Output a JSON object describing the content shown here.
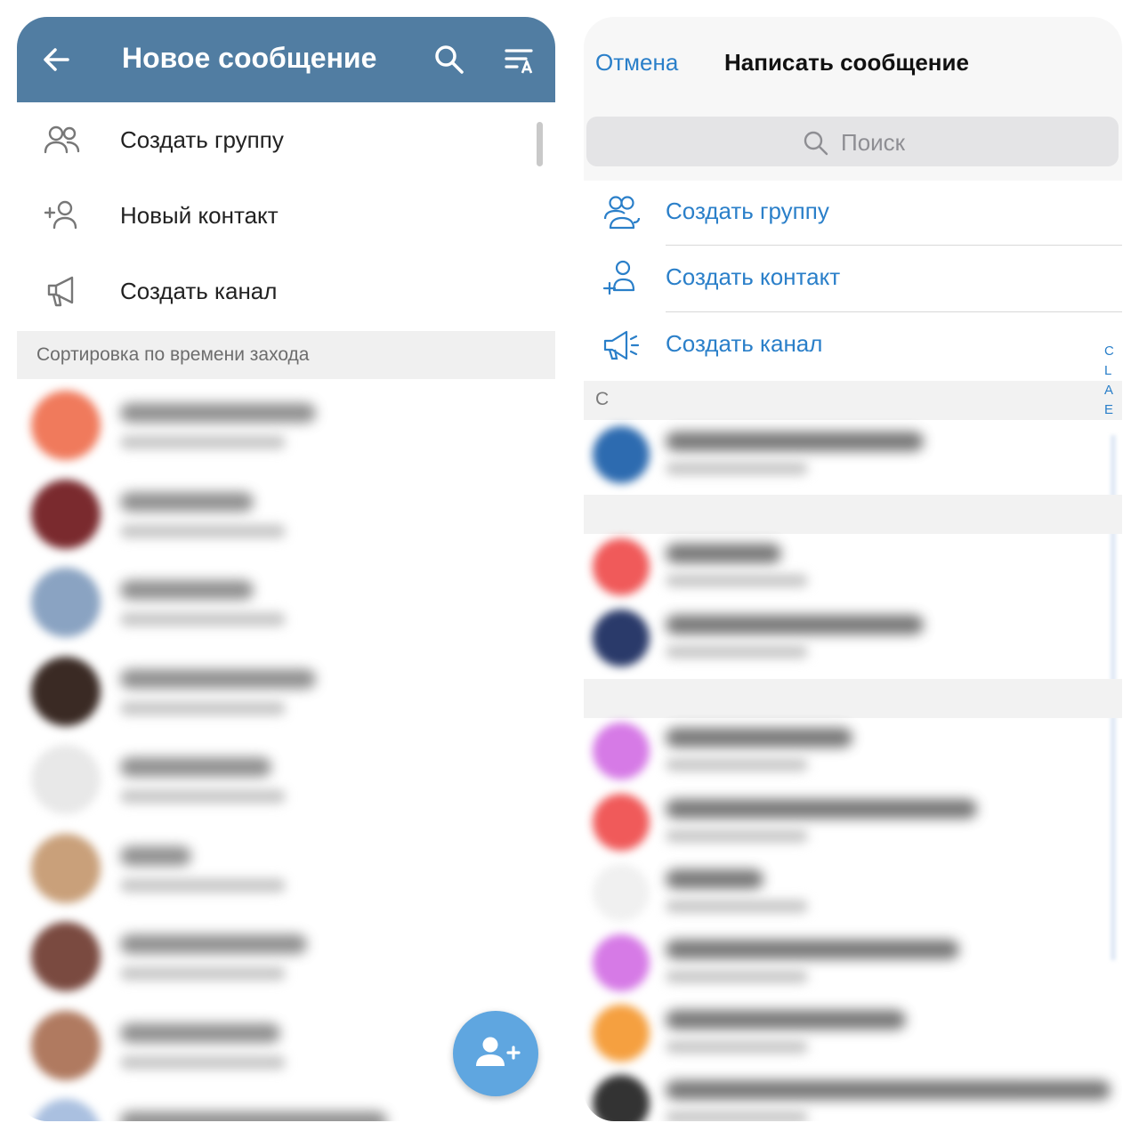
{
  "android": {
    "header": {
      "title": "Новое сообщение",
      "back_icon": "arrow-left-icon",
      "search_icon": "search-icon",
      "sort_icon": "sort-alpha-icon",
      "background": "#517da2"
    },
    "actions": [
      {
        "label": "Создать группу",
        "icon": "group-icon"
      },
      {
        "label": "Новый контакт",
        "icon": "add-contact-icon"
      },
      {
        "label": "Создать канал",
        "icon": "megaphone-icon"
      }
    ],
    "section_label": "Сортировка по времени захода",
    "contacts_blurred": true,
    "fab_icon": "add-person-icon",
    "fab_color": "#5fa6e0"
  },
  "ios": {
    "header": {
      "cancel": "Отмена",
      "title": "Написать сообщение"
    },
    "search": {
      "placeholder": "Поиск",
      "icon": "search-icon"
    },
    "actions": [
      {
        "label": "Создать группу",
        "icon": "group-icon"
      },
      {
        "label": "Создать контакт",
        "icon": "add-contact-icon"
      },
      {
        "label": "Создать канал",
        "icon": "megaphone-icon"
      }
    ],
    "section_letter": "С",
    "index_letters": [
      "C",
      "L",
      "A",
      "E"
    ],
    "contacts_blurred": true,
    "accent": "#2a7fc9"
  }
}
